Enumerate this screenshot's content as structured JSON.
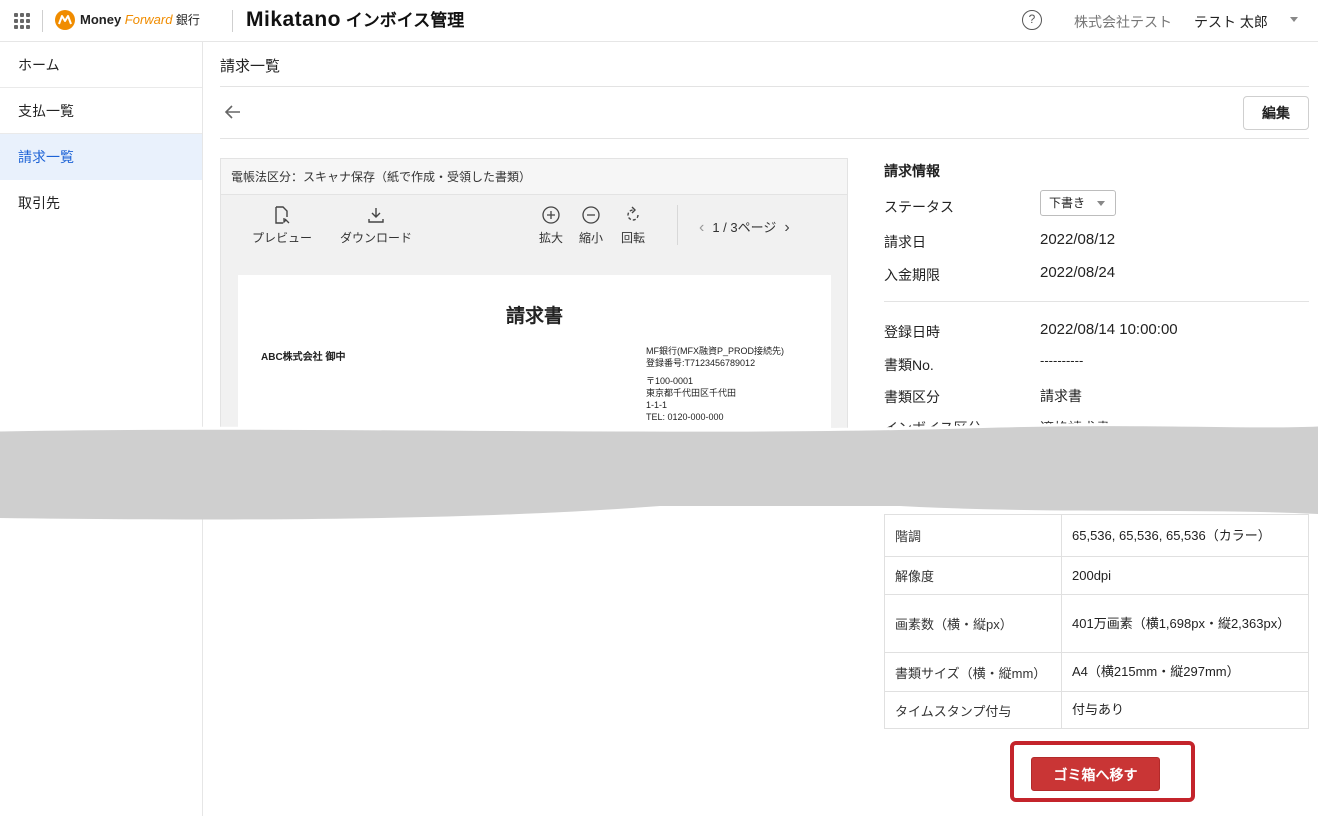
{
  "header": {
    "brand_money": "Money ",
    "brand_forward": "Forward",
    "brand_bank": " 銀行",
    "product_name": "Mikatano",
    "product_suffix": " インボイス管理",
    "help_glyph": "?",
    "company": "株式会社テスト",
    "user": "テスト 太郎"
  },
  "sidebar": {
    "items": [
      {
        "label": "ホーム",
        "active": false
      },
      {
        "label": "支払一覧",
        "active": false
      },
      {
        "label": "請求一覧",
        "active": true
      },
      {
        "label": "取引先",
        "active": false
      }
    ]
  },
  "main": {
    "title": "請求一覧",
    "edit_label": "編集"
  },
  "viewer": {
    "storage_label": "電帳法区分：スキャナ保存（紙で作成・受領した書類）",
    "tools": {
      "preview": "プレビュー",
      "download": "ダウンロード",
      "zoom_in": "拡大",
      "zoom_out": "縮小",
      "rotate": "回転"
    },
    "pager": "1 / 3ページ",
    "document": {
      "title": "請求書",
      "to": "ABC株式会社 御中",
      "from_lines": [
        "MF銀行(MFX融資P_PROD接続先)",
        "登録番号:T7123456789012",
        "",
        "〒100-0001",
        "東京都千代田区千代田",
        "1-1-1",
        "TEL: 0120-000-000"
      ]
    }
  },
  "info": {
    "section_title": "請求情報",
    "status_label": "ステータス",
    "status_value": "下書き",
    "billing_date_label": "請求日",
    "billing_date": "2022/08/12",
    "due_date_label": "入金期限",
    "due_date": "2022/08/24",
    "registered_label": "登録日時",
    "registered": "2022/08/14 10:00:00",
    "doc_no_label": "書類No.",
    "doc_no": "----------",
    "doc_type_label": "書類区分",
    "doc_type": "請求書",
    "partial_label": "インボイス区分",
    "partial_value": "適格請求書"
  },
  "spec_rows": [
    {
      "label": "階調",
      "value": "65,536, 65,536, 65,536（カラー）"
    },
    {
      "label": "解像度",
      "value": "200dpi"
    },
    {
      "label": "画素数（横・縦px）",
      "value": "401万画素（横1,698px・縦2,363px）"
    },
    {
      "label": "書類サイズ（横・縦mm）",
      "value": "A4（横215mm・縦297mm）"
    },
    {
      "label": "タイムスタンプ付与",
      "value": "付与あり"
    }
  ],
  "actions": {
    "trash_label": "ゴミ箱へ移す"
  },
  "colors": {
    "accent": "#1d63d6",
    "danger": "#c93535",
    "highlight_frame": "#c4242b",
    "brand_orange": "#f08c00"
  }
}
